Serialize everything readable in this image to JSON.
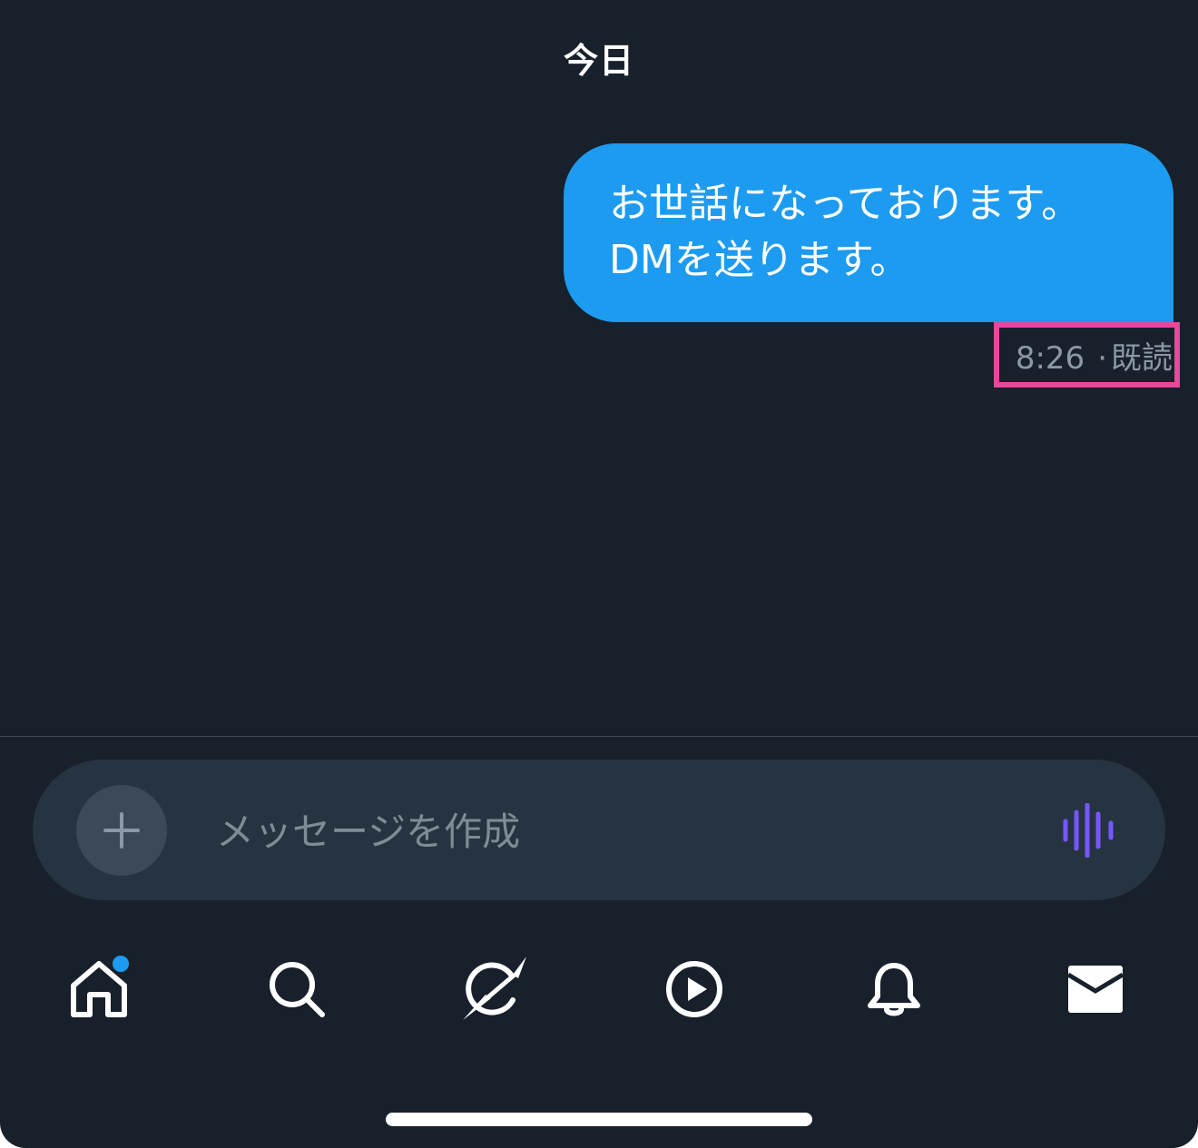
{
  "conversation": {
    "date_label": "今日",
    "messages": [
      {
        "lines": [
          "お世話になっております。",
          "DMを送ります。"
        ],
        "time": "8:26",
        "separator": "·",
        "status": "既読"
      }
    ]
  },
  "composer": {
    "placeholder": "メッセージを作成",
    "add_icon": "plus-icon",
    "voice_icon": "voice-waveform-icon",
    "voice_color": "#7856ff"
  },
  "tabbar": {
    "items": [
      {
        "icon": "home-icon",
        "has_badge": true
      },
      {
        "icon": "search-icon"
      },
      {
        "icon": "grok-icon"
      },
      {
        "icon": "play-icon"
      },
      {
        "icon": "bell-icon"
      },
      {
        "icon": "mail-icon",
        "active": true
      }
    ],
    "badge_color": "#1d9bf0"
  },
  "colors": {
    "background": "#17202b",
    "bubble": "#1d9bf0",
    "highlight": "#e8479a",
    "meta_text": "#8b98a5"
  }
}
